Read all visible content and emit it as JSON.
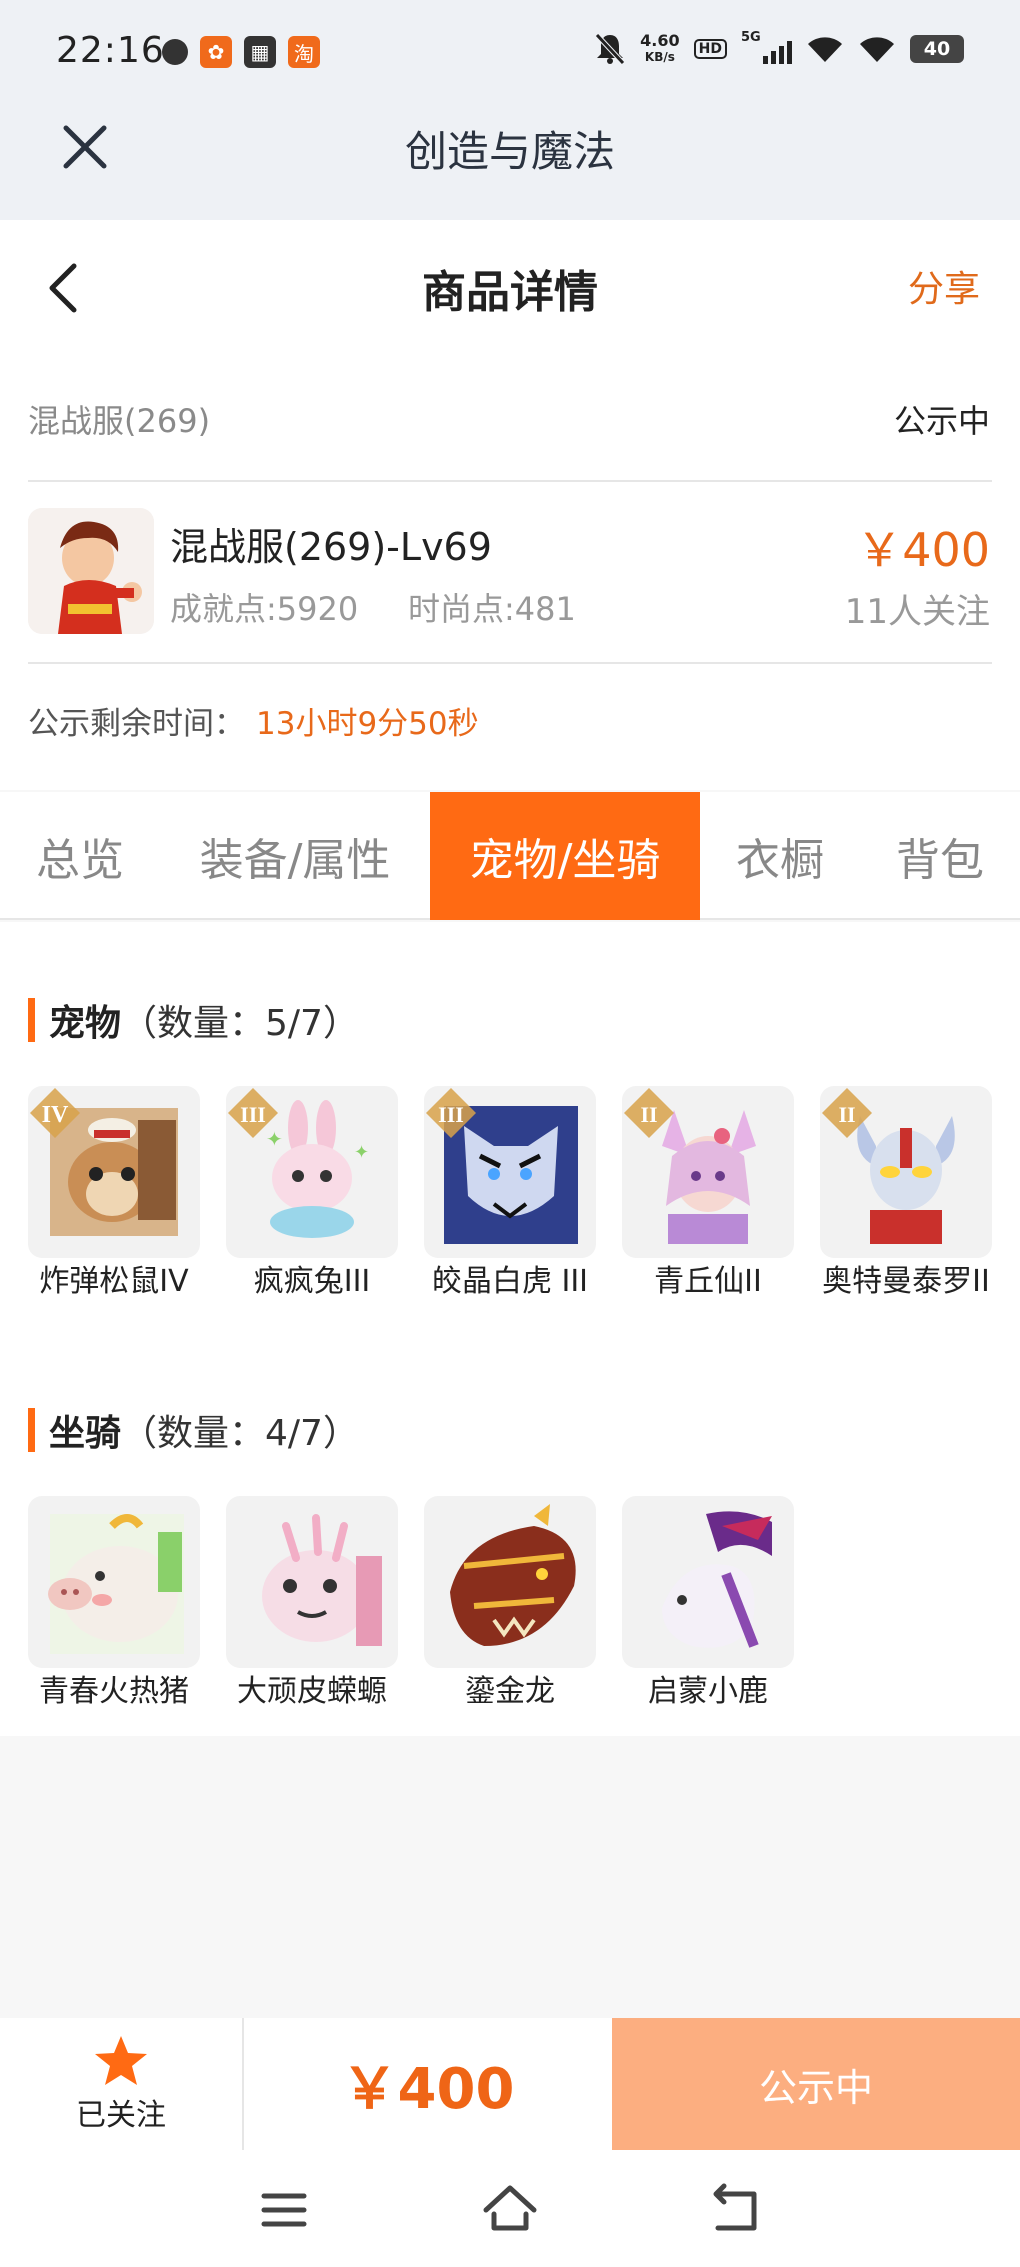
{
  "status_bar": {
    "time": "22:16",
    "net_speed_value": "4.60",
    "net_speed_unit": "KB/s",
    "hd_badge": "HD",
    "signal_label": "5G",
    "battery": "40",
    "app_badge_taobao": "淘"
  },
  "app_bar": {
    "title": "创造与魔法"
  },
  "header": {
    "title": "商品详情",
    "share": "分享"
  },
  "listing": {
    "server": "混战服(269)",
    "status": "公示中",
    "character_name": "混战服(269)-Lv69",
    "achievement": "成就点:5920",
    "fashion": "时尚点:481",
    "price": "￥400",
    "followers": "11人关注",
    "remain_label": "公示剩余时间：",
    "remain_value": "13小时9分50秒"
  },
  "tabs": [
    {
      "label": "总览"
    },
    {
      "label": "装备/属性"
    },
    {
      "label": "宠物/坐骑"
    },
    {
      "label": "衣橱"
    },
    {
      "label": "背包"
    }
  ],
  "pets": {
    "title": "宠物",
    "count": "（数量：5/7）",
    "items": [
      {
        "name": "炸弹松鼠IV",
        "tier": "IV",
        "color": "#c98e55"
      },
      {
        "name": "疯疯兔III",
        "tier": "III",
        "color": "#f5c7d8"
      },
      {
        "name": "皎晶白虎 III",
        "tier": "III",
        "color": "#4a5fa8"
      },
      {
        "name": "青丘仙II",
        "tier": "II",
        "color": "#e3b8e0"
      },
      {
        "name": "奥特曼泰罗II",
        "tier": "II",
        "color": "#c6d3ea"
      }
    ]
  },
  "mounts": {
    "title": "坐骑",
    "count": "（数量：4/7）",
    "items": [
      {
        "name": "青春火热猪",
        "color": "#f1ece6"
      },
      {
        "name": "大顽皮蝾螈",
        "color": "#f6dde6"
      },
      {
        "name": "鎏金龙",
        "color": "#8a2e1c"
      },
      {
        "name": "启蒙小鹿",
        "color": "#d8cce8"
      }
    ]
  },
  "bottom_bar": {
    "follow_label": "已关注",
    "price": "￥400",
    "action": "公示中"
  },
  "colors": {
    "accent": "#ff6a13",
    "price": "#e8691a",
    "action_bg": "#fcae80"
  }
}
